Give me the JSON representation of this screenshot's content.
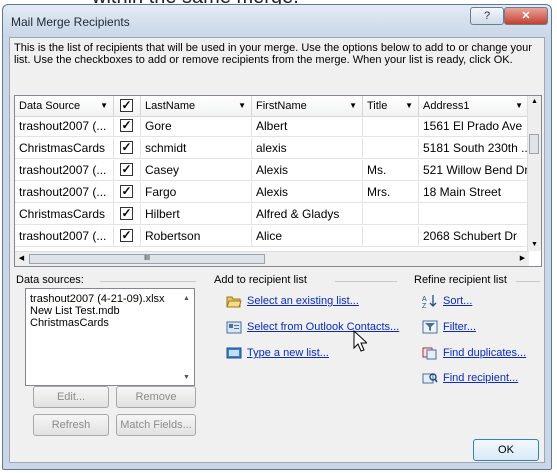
{
  "background_caption": "within the same merge.",
  "dialog": {
    "title": "Mail Merge Recipients",
    "help_label": "?",
    "close_label": "✕",
    "intro": "This is the list of recipients that will be used in your merge.  Use the options below to add to or change your list.  Use the checkboxes to add or remove recipients from the merge.  When your list is ready, click OK."
  },
  "grid": {
    "columns": [
      "Data Source",
      "",
      "LastName",
      "FirstName",
      "Title",
      "Address1"
    ],
    "rows": [
      {
        "source": "trashout2007 (...",
        "checked": true,
        "last": "Gore",
        "first": "Albert",
        "title": "",
        "address": "1561 El Prado Ave"
      },
      {
        "source": "ChristmasCards",
        "checked": true,
        "last": "schmidt",
        "first": "alexis",
        "title": "",
        "address": "5181 South 230th ..."
      },
      {
        "source": "trashout2007 (...",
        "checked": true,
        "last": "Casey",
        "first": "Alexis",
        "title": "Ms.",
        "address": "521 Willow Bend Dr"
      },
      {
        "source": "trashout2007 (...",
        "checked": true,
        "last": "Fargo",
        "first": "Alexis",
        "title": "Mrs.",
        "address": "18 Main Street"
      },
      {
        "source": "ChristmasCards",
        "checked": true,
        "last": "Hilbert",
        "first": "Alfred & Gladys",
        "title": "",
        "address": ""
      },
      {
        "source": "trashout2007 (...",
        "checked": true,
        "last": "Robertson",
        "first": "Alice",
        "title": "",
        "address": "2068 Schubert Dr"
      }
    ],
    "scroll_thumb_label": "III"
  },
  "data_sources": {
    "label": "Data sources:",
    "items": [
      "trashout2007 (4-21-09).xlsx",
      "New List Test.mdb",
      "ChristmasCards"
    ],
    "edit_label": "Edit...",
    "remove_label": "Remove",
    "refresh_label": "Refresh",
    "match_fields_label": "Match Fields..."
  },
  "add_section": {
    "label": "Add to recipient list",
    "links": [
      "Select an existing list...",
      "Select from Outlook Contacts...",
      "Type a new list..."
    ]
  },
  "refine_section": {
    "label": "Refine recipient list",
    "links": [
      "Sort...",
      "Filter...",
      "Find duplicates...",
      "Find recipient..."
    ]
  },
  "ok_label": "OK",
  "colors": {
    "link": "#0a2bbd",
    "frame": "#cbd7e6",
    "close_button": "#c5402f"
  }
}
